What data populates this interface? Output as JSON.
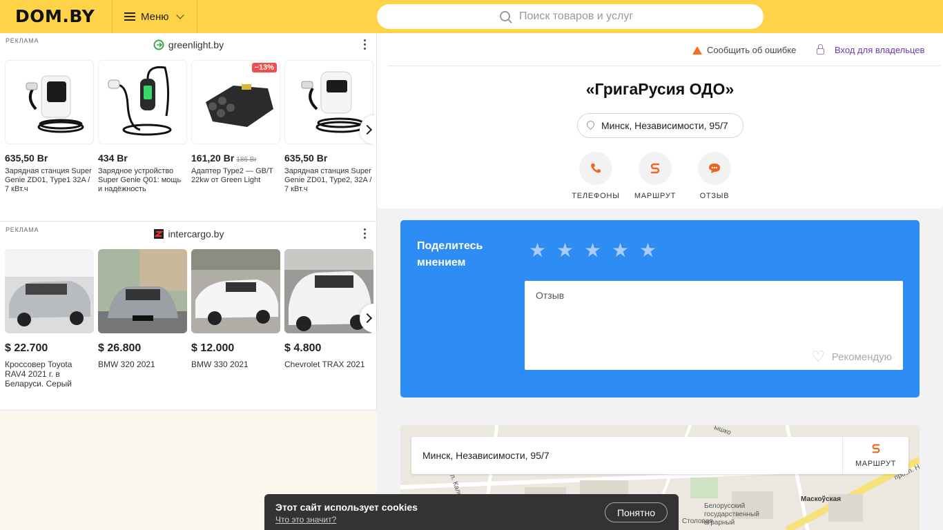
{
  "header": {
    "logo": "DOM.BY",
    "menu_label": "Меню",
    "search_placeholder": "Поиск товаров и услуг"
  },
  "ads": [
    {
      "label": "РЕКЛАМА",
      "source": "greenlight.by",
      "items": [
        {
          "price": "635,50 Br",
          "old_price": "",
          "badge": "",
          "title": "Зарядная станция Super Genie ZD01, Type1 32A / 7 кВт.ч"
        },
        {
          "price": "434 Br",
          "old_price": "",
          "badge": "",
          "title": "Зарядное устройство Super Genie Q01: мощь и надёжность"
        },
        {
          "price": "161,20 Br",
          "old_price": "186 Br",
          "badge": "−13%",
          "title": "Адаптер Type2 — GB/T 22kw от Green Light"
        },
        {
          "price": "635,50 Br",
          "old_price": "",
          "badge": "",
          "title": "Зарядная станция Super Genie ZD01, Type2, 32A / 7 кВт.ч"
        }
      ]
    },
    {
      "label": "РЕКЛАМА",
      "source": "intercargo.by",
      "items": [
        {
          "price": "$ 22.700",
          "title": "Кроссовер Toyota RAV4 2021 г. в Беларуси. Серый"
        },
        {
          "price": "$ 26.800",
          "title": "BMW 320 2021"
        },
        {
          "price": "$ 12.000",
          "title": "BMW 330 2021"
        },
        {
          "price": "$ 4.800",
          "title": "Chevrolet TRAX 2021"
        }
      ]
    }
  ],
  "company": {
    "report_error": "Сообщить об ошибке",
    "owner_login": "Вход для владельцев",
    "title": "«ГригаРусия ОДО»",
    "address": "Минск, Независимости, 95/7",
    "actions": [
      {
        "label": "ТЕЛЕФОНЫ",
        "icon": "phone-icon"
      },
      {
        "label": "МАРШРУТ",
        "icon": "route-icon"
      },
      {
        "label": "ОТЗЫВ",
        "icon": "chat-icon"
      }
    ]
  },
  "review": {
    "title": "Поделитесь мнением",
    "placeholder": "Отзыв",
    "recommend": "Рекомендую",
    "star_count": 5
  },
  "map": {
    "address": "Минск, Независимости, 95/7",
    "route_label": "МАРШРУТ",
    "labels": [
      "Белорусский государственный аграрный",
      "Маскоўская",
      "просп. Не",
      "ул. Кали",
      "ышко",
      "Столовая"
    ]
  },
  "cookie": {
    "title": "Этот сайт использует cookies",
    "link": "Что это значит?",
    "button": "Понятно"
  },
  "colors": {
    "header_bg": "#ffd348",
    "accent_orange": "#f0641e",
    "review_blue": "#2e8cf5",
    "owner_link": "#6a3aa8"
  }
}
